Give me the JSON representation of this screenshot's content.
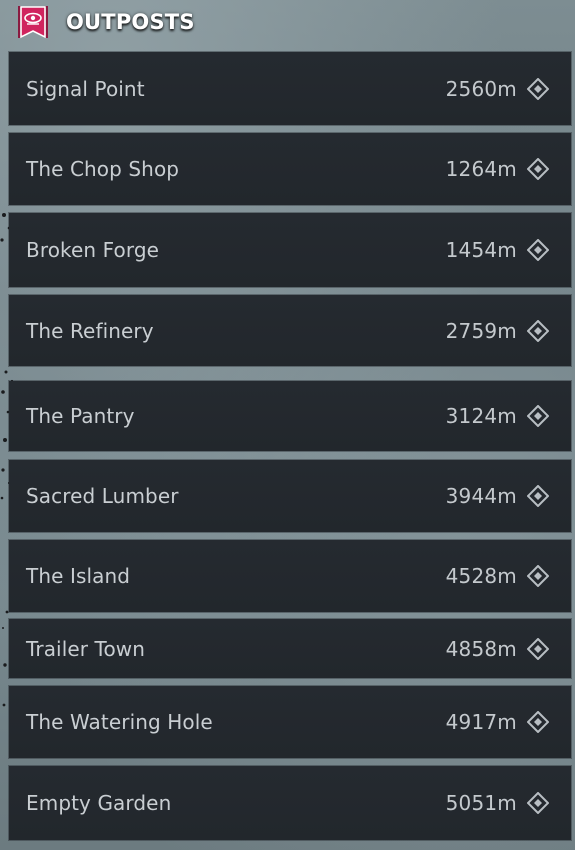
{
  "header": {
    "title": "OUTPOSTS",
    "icon": "outposts-banner-icon",
    "icon_color": "#d0245e"
  },
  "outposts": [
    {
      "name": "Signal Point",
      "distance": "2560m",
      "icon": "waypoint-diamond-icon"
    },
    {
      "name": "The Chop Shop",
      "distance": "1264m",
      "icon": "waypoint-diamond-icon"
    },
    {
      "name": "Broken Forge",
      "distance": "1454m",
      "icon": "waypoint-diamond-icon"
    },
    {
      "name": "The Refinery",
      "distance": "2759m",
      "icon": "waypoint-diamond-icon"
    },
    {
      "name": "The Pantry",
      "distance": "3124m",
      "icon": "waypoint-diamond-icon"
    },
    {
      "name": "Sacred Lumber",
      "distance": "3944m",
      "icon": "waypoint-diamond-icon"
    },
    {
      "name": "The Island",
      "distance": "4528m",
      "icon": "waypoint-diamond-icon"
    },
    {
      "name": "Trailer Town",
      "distance": "4858m",
      "icon": "waypoint-diamond-icon"
    },
    {
      "name": "The Watering Hole",
      "distance": "4917m",
      "icon": "waypoint-diamond-icon"
    },
    {
      "name": "Empty Garden",
      "distance": "5051m",
      "icon": "waypoint-diamond-icon"
    }
  ]
}
